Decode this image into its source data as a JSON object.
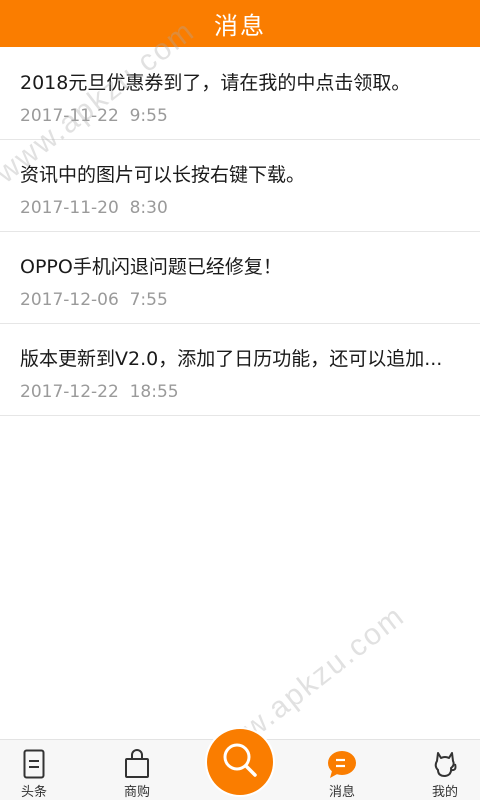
{
  "header": {
    "title": "消息"
  },
  "messages": [
    {
      "title": "2018元旦优惠券到了，请在我的中点击领取。",
      "date": "2017-11-22",
      "time": "9:55"
    },
    {
      "title": "资讯中的图片可以长按右键下载。",
      "date": "2017-11-20",
      "time": "8:30"
    },
    {
      "title": "OPPO手机闪退问题已经修复！",
      "date": "2017-12-06",
      "time": "7:55"
    },
    {
      "title": "版本更新到V2.0，添加了日历功能，还可以追加...",
      "date": "2017-12-22",
      "time": "18:55"
    }
  ],
  "watermarks": [
    "www.apkzu.com",
    "www.apkzu.com"
  ],
  "tabbar": {
    "tabs": [
      {
        "label": "头条",
        "icon": "document-icon"
      },
      {
        "label": "商购",
        "icon": "shopping-bag-icon"
      },
      {
        "label": "消息",
        "icon": "chat-bubble-icon",
        "active": true
      },
      {
        "label": "我的",
        "icon": "cat-profile-icon"
      }
    ],
    "search_icon": "search-icon"
  },
  "colors": {
    "accent": "#fa7d00",
    "text": "#1a1a1a",
    "muted": "#9a9a9a"
  }
}
